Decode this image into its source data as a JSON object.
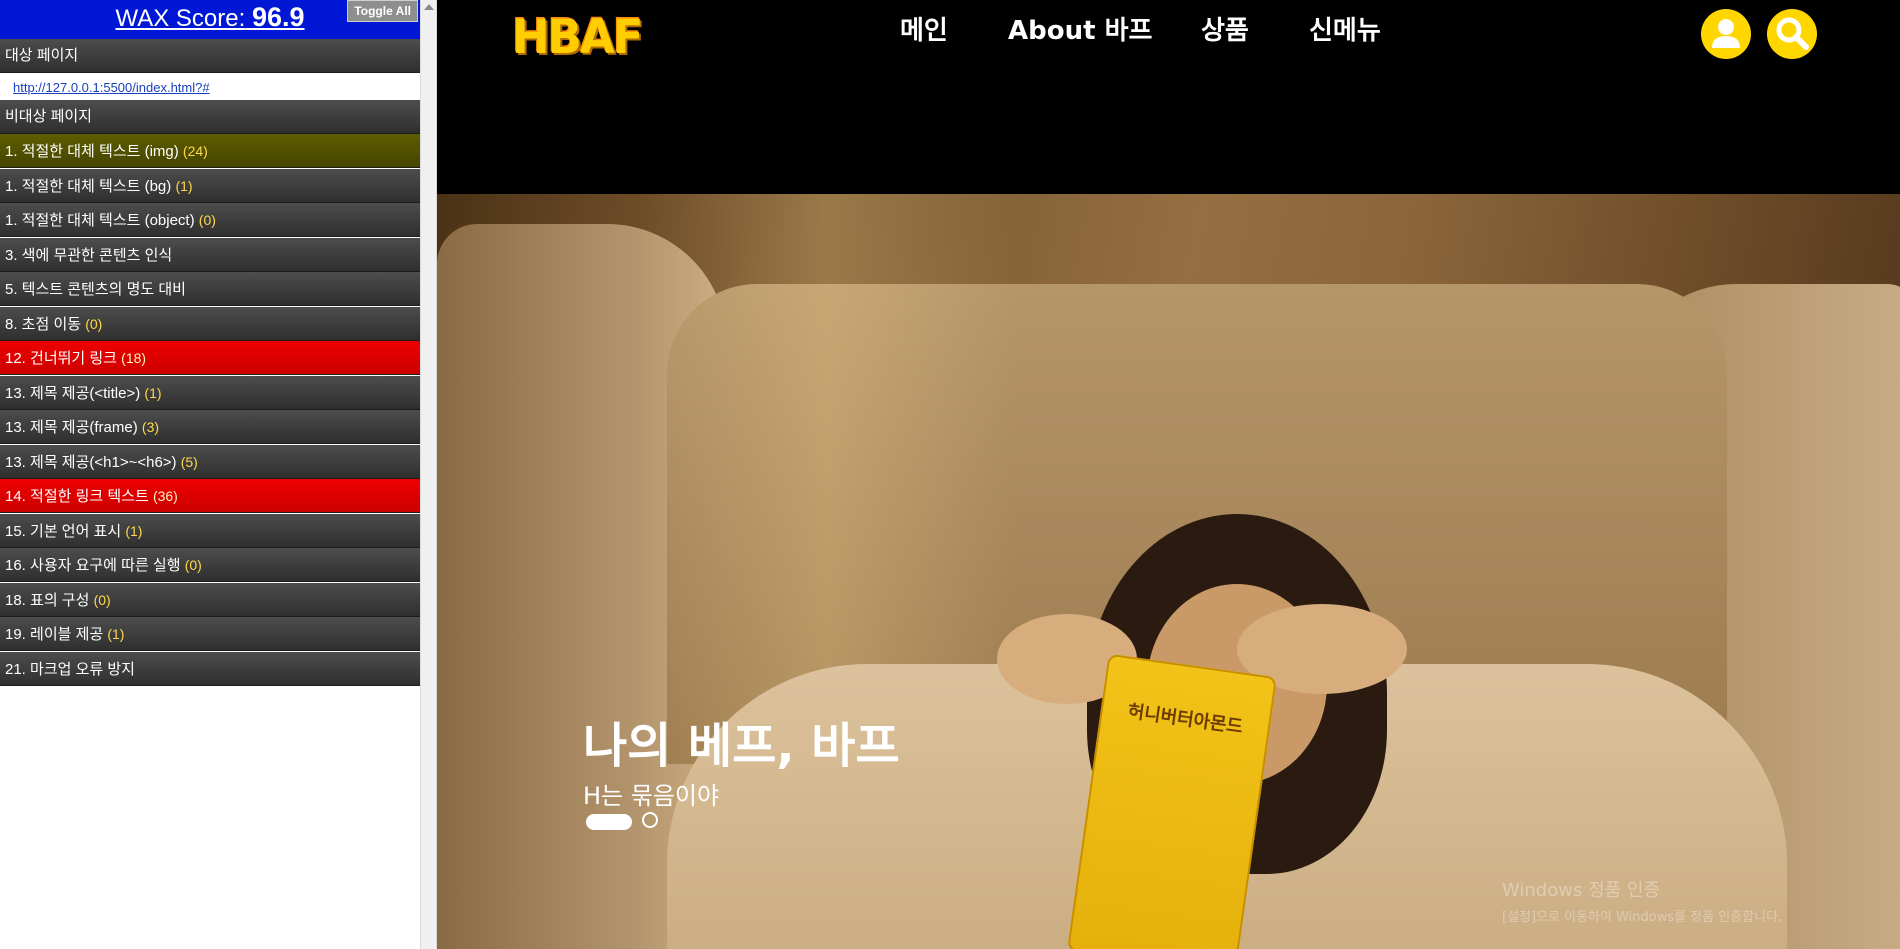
{
  "wax": {
    "score_label": "WAX Score:",
    "score_value": "96.9",
    "toggle_label": "Toggle All",
    "target_label": "대상 페이지",
    "target_url": "http://127.0.0.1:5500/index.html?#",
    "non_target_label": "비대상 페이지",
    "items": [
      {
        "label": "1. 적절한 대체 텍스트 (img)",
        "count": "(24)",
        "status": "warning"
      },
      {
        "label": "1. 적절한 대체 텍스트 (bg)",
        "count": "(1)",
        "status": "normal"
      },
      {
        "label": "1. 적절한 대체 텍스트 (object)",
        "count": "(0)",
        "status": "normal"
      },
      {
        "label": "3. 색에 무관한 콘텐츠 인식",
        "count": "",
        "status": "normal"
      },
      {
        "label": "5. 텍스트 콘텐츠의 명도 대비",
        "count": "",
        "status": "normal"
      },
      {
        "label": "8. 초점 이동",
        "count": "(0)",
        "status": "normal"
      },
      {
        "label": "12. 건너뛰기 링크",
        "count": "(18)",
        "status": "error"
      },
      {
        "label": "13. 제목 제공(<title>)",
        "count": "(1)",
        "status": "normal"
      },
      {
        "label": "13. 제목 제공(frame)",
        "count": "(3)",
        "status": "normal"
      },
      {
        "label": "13. 제목 제공(<h1>~<h6>)",
        "count": "(5)",
        "status": "normal"
      },
      {
        "label": "14. 적절한 링크 텍스트",
        "count": "(36)",
        "status": "error"
      },
      {
        "label": "15. 기본 언어 표시",
        "count": "(1)",
        "status": "normal"
      },
      {
        "label": "16. 사용자 요구에 따른 실행",
        "count": "(0)",
        "status": "normal"
      },
      {
        "label": "18. 표의 구성",
        "count": "(0)",
        "status": "normal"
      },
      {
        "label": "19. 레이블 제공",
        "count": "(1)",
        "status": "normal"
      },
      {
        "label": "21. 마크업 오류 방지",
        "count": "",
        "status": "normal"
      }
    ],
    "colors": {
      "header": "#0018d6",
      "warning": "#5d5d00",
      "error": "#e00000",
      "row": "#3a3a3a",
      "count": "#ffd84a"
    }
  },
  "site": {
    "logo": "HBAF",
    "logo_tm": "™",
    "nav": [
      "메인",
      "About 바프",
      "상품",
      "신메뉴"
    ],
    "user_icon": "user-icon",
    "search_icon": "search-icon",
    "accent_color": "#ffd600",
    "hero": {
      "title": "나의 베프, 바프",
      "subtitle": "H는 묶음이야",
      "snack_text": "허니버터아몬드",
      "slides": 2,
      "active_slide": 1
    }
  },
  "os_overlay": {
    "line1": "Windows 정품 인증",
    "line2": "[설정]으로 이동하여 Windows를 정품 인증합니다."
  }
}
